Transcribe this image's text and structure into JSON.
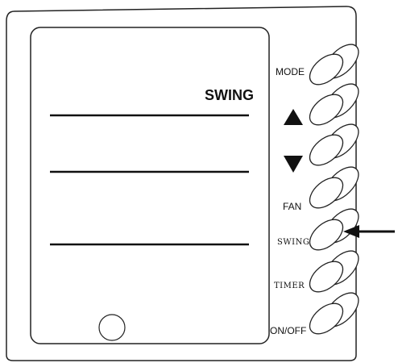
{
  "display": {
    "text": "SWING"
  },
  "buttons": [
    {
      "id": "mode",
      "label": "MODE",
      "icon": ""
    },
    {
      "id": "up",
      "label": "",
      "icon": "up-triangle-icon"
    },
    {
      "id": "down",
      "label": "",
      "icon": "down-triangle-icon"
    },
    {
      "id": "fan",
      "label": "FAN",
      "icon": ""
    },
    {
      "id": "swing",
      "label": "SWING",
      "icon": ""
    },
    {
      "id": "timer",
      "label": "TIMER",
      "icon": ""
    },
    {
      "id": "onoff",
      "label": "ON/OFF",
      "icon": ""
    }
  ],
  "indicator": {
    "icon": "left-arrow-icon",
    "points_to": "swing"
  }
}
